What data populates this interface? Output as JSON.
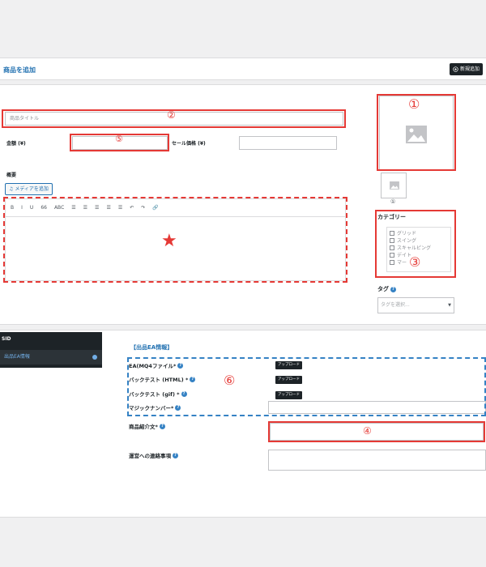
{
  "header": {
    "title": "商品を追加",
    "new_button": "新規追加"
  },
  "product": {
    "title_placeholder": "商品タイトル",
    "price_label": "金額 (¥)",
    "sale_price_label": "セール価格 (¥)",
    "summary_label": "概要",
    "media_button": "メディアを追加"
  },
  "editor_toolbar": [
    "B",
    "I",
    "U",
    "66",
    "ABC",
    "☰",
    "☰",
    "☰",
    "☰",
    "☰",
    "↶",
    "↷",
    "🔗"
  ],
  "categories": {
    "title": "カテゴリー",
    "items": [
      "グリッド",
      "スイング",
      "スキャルピング",
      "デイト",
      "マー"
    ]
  },
  "tags": {
    "title": "タグ",
    "placeholder": "タグを選択..."
  },
  "sidebar": {
    "heading": "SID",
    "item": "出品EA情報"
  },
  "ea_section": {
    "title": "【出品EA情報】",
    "fields": {
      "ea_file": "EA(MQ4ファイル*",
      "backtest_html": "バックテスト (HTML) *",
      "backtest_gif": "バックテスト (gif) *",
      "magic_number": "マジックナンバー*",
      "intro": "商品紹介文*",
      "notes": "運営への連絡事項"
    },
    "upload_label": "アップロード"
  },
  "markers": {
    "m1": "①",
    "m2": "②",
    "m3": "③",
    "m4": "④",
    "m5": "⑤",
    "m6": "⑥",
    "m_small": "①",
    "star": "★"
  },
  "colors": {
    "marker_red": "#e53935",
    "accent_blue": "#2271b1",
    "dark": "#1d2327"
  }
}
